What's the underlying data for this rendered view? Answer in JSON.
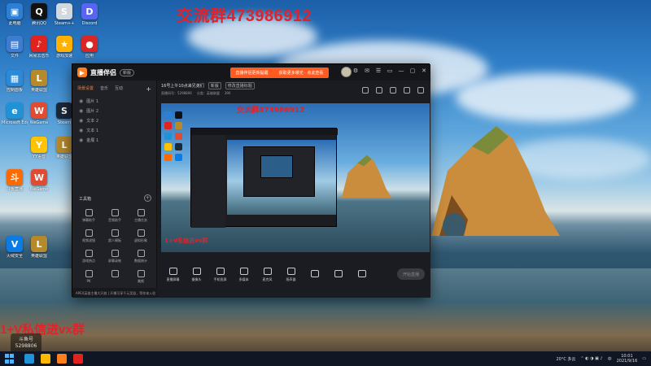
{
  "overlay": {
    "qq_group": "交流群473986912",
    "vx_group": "1+V私信进vx群",
    "watermark_name": "斗鱼号",
    "watermark_id": "5298806"
  },
  "desktop_icons": [
    {
      "label": "此电脑",
      "color": "#2d7fd6",
      "glyph": "▣"
    },
    {
      "label": "腾讯QQ",
      "color": "#111",
      "glyph": "Q"
    },
    {
      "label": "Steam++",
      "color": "#d2d8e0",
      "glyph": "S"
    },
    {
      "label": "Discord",
      "color": "#5865f2",
      "glyph": "D"
    },
    {
      "label": "文件",
      "color": "#3d7cd0",
      "glyph": "▤"
    },
    {
      "label": "网易云音乐",
      "color": "#e1231f",
      "glyph": "♪"
    },
    {
      "label": "游戏加速",
      "color": "#ffb000",
      "glyph": "★"
    },
    {
      "label": "应用",
      "color": "#d92727",
      "glyph": "●"
    },
    {
      "label": "控制面板",
      "color": "#2a8ad8",
      "glyph": "▦"
    },
    {
      "label": "英雄联盟",
      "color": "#b48a2c",
      "glyph": "L"
    },
    {
      "label": "Microsoft Edge",
      "color": "#1e93d8",
      "glyph": "e"
    },
    {
      "label": "WeGame",
      "color": "#e04b32",
      "glyph": "W"
    },
    {
      "label": "Steam",
      "color": "#1b2838",
      "glyph": "S"
    },
    {
      "label": "YY语音",
      "color": "#ffc400",
      "glyph": "Y"
    },
    {
      "label": "英雄联盟",
      "color": "#b48a2c",
      "glyph": "L"
    },
    {
      "label": "斗鱼直播",
      "color": "#ff6a00",
      "glyph": "斗"
    },
    {
      "label": "WeGame",
      "color": "#e04b32",
      "glyph": "W"
    },
    {
      "label": "火绒安全",
      "color": "#0b7be6",
      "glyph": "V"
    },
    {
      "label": "英雄联盟",
      "color": "#b48a2c",
      "glyph": "L"
    }
  ],
  "app": {
    "name": "直播伴侣",
    "version": "新版",
    "promo_left": "直播伴侣更新提醒",
    "promo_right": "获取更多曝光 · 点此查看",
    "window_buttons": [
      "⚙",
      "✉",
      "☰",
      "▭",
      "—",
      "▢",
      "✕"
    ]
  },
  "left_panel": {
    "tabs": [
      {
        "label": "场景设置",
        "active": true
      },
      {
        "label": "音乐",
        "active": false
      },
      {
        "label": "互动",
        "active": false
      }
    ],
    "add": "+",
    "scenes": [
      "图片 1",
      "图片 2",
      "文本 2",
      "文本 1",
      "金展 1"
    ],
    "tools_title": "工具箱",
    "tools": [
      "弹幕助手",
      "音频助手",
      "主播任务",
      "视频滤镜",
      "超人模板",
      "虚拟形象",
      "游戏热点",
      "屏幕录制",
      "数据统计",
      "PK",
      "",
      "美颜"
    ],
    "ticker": "APEX英雄主播大开放 | 开播可享千元奖励，等你来入驻"
  },
  "main": {
    "room_title": "16号上午10点来兄弟们",
    "room_tag": "新版",
    "room_edit": "修改直播标题",
    "room_id": "直播间号：5298806",
    "room_category": "分类：英雄联盟",
    "room_fans": "390",
    "preview_qq": "交流群473986912",
    "preview_vx": "1+V私信进vx群",
    "bottom_tools": [
      "直播屏幕",
      "摄像头",
      "手机投屏",
      "多媒体",
      "麦克风",
      "扬声器",
      "",
      "",
      ""
    ],
    "live_button": "开始直播"
  },
  "taskbar": {
    "weather": "20°C 多云",
    "time": "10:01",
    "date": "2021/9/16",
    "lang": "中"
  }
}
